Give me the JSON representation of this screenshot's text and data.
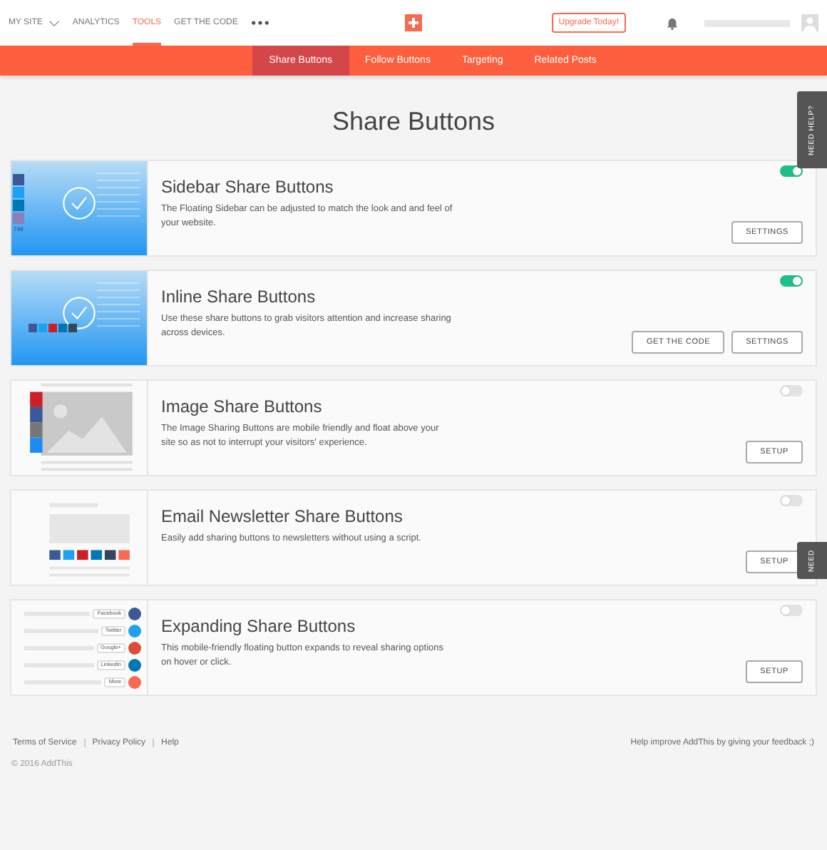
{
  "nav": {
    "items": [
      {
        "label": "MY SITE",
        "kind": "dropdown",
        "selected": false
      },
      {
        "label": "ANALYTICS",
        "kind": "link",
        "selected": false
      },
      {
        "label": "TOOLS",
        "kind": "link",
        "selected": true
      },
      {
        "label": "GET THE CODE",
        "kind": "link",
        "selected": false
      }
    ],
    "upgrade_button": "Upgrade Today!"
  },
  "subnav": [
    {
      "label": "Share Buttons",
      "selected": true
    },
    {
      "label": "Follow Buttons",
      "selected": false
    },
    {
      "label": "Targeting",
      "selected": false
    },
    {
      "label": "Related Posts",
      "selected": false
    }
  ],
  "page_title": "Share Buttons",
  "help_tabs": [
    "NEED HELP?",
    "NEED"
  ],
  "tools": [
    {
      "kind": "sidebar",
      "title": "Sidebar Share Buttons",
      "description": "The Floating Sidebar can be adjusted to match the look and and feel of your website.",
      "on": true,
      "buttons": [
        "SETTINGS"
      ],
      "thumbnail_labels": [
        "749"
      ]
    },
    {
      "kind": "inline",
      "title": "Inline Share Buttons",
      "description": "Use these share buttons to grab visitors attention and increase sharing across devices.",
      "on": true,
      "buttons": [
        "GET THE CODE",
        "SETTINGS"
      ]
    },
    {
      "kind": "image",
      "title": "Image Share Buttons",
      "description": "The Image Sharing Buttons are mobile friendly and float above your site so as not to interrupt your visitors' experience.",
      "on": false,
      "buttons": [
        "SETUP"
      ]
    },
    {
      "kind": "email",
      "title": "Email Newsletter Share Buttons",
      "description": "Easily add sharing buttons to newsletters without using a script.",
      "on": false,
      "buttons": [
        "SETUP"
      ]
    },
    {
      "kind": "expanding",
      "title": "Expanding Share Buttons",
      "description": "This mobile-friendly floating button expands to reveal sharing options on hover or click.",
      "on": false,
      "buttons": [
        "SETUP"
      ],
      "thumbnail_labels": [
        "Facebook",
        "Twitter",
        "Google+",
        "LinkedIn",
        "More"
      ]
    }
  ],
  "footer": {
    "links": [
      "Terms of Service",
      "Privacy Policy",
      "Help"
    ],
    "copyright": "© 2016 AddThis",
    "feedback": "Help improve AddThis by giving your feedback ;)"
  }
}
